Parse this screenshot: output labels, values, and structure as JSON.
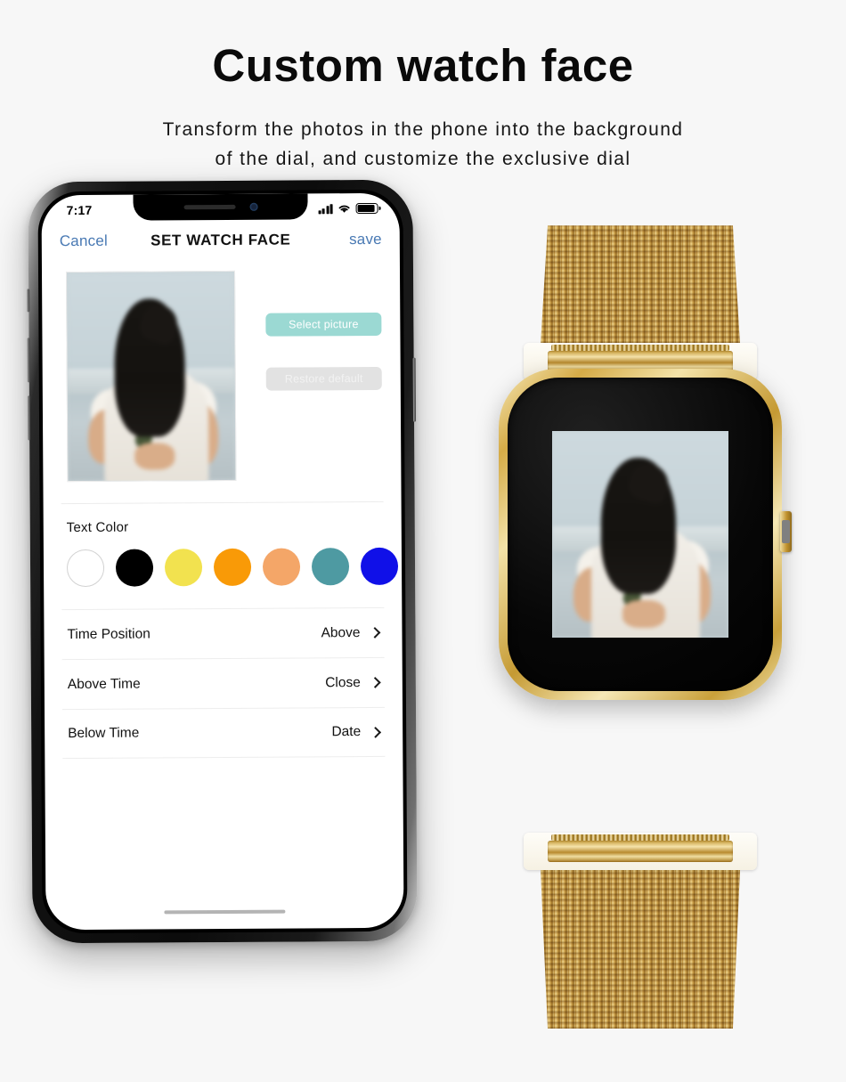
{
  "header": {
    "headline": "Custom watch face",
    "subline_line1": "Transform  the  photos  in  the  phone  into  the  background",
    "subline_line2": "of the dial, and customize the exclusive dial"
  },
  "phone": {
    "status_bar": {
      "time": "7:17",
      "signal_icon": "signal-bars-icon",
      "wifi_icon": "wifi-icon",
      "battery_icon": "battery-icon"
    },
    "nav_bar": {
      "cancel_label": "Cancel",
      "title": "SET WATCH FACE",
      "save_label": "save"
    },
    "editor": {
      "select_picture_label": "Select picture",
      "restore_default_label": "Restore default",
      "select_picture_color": "#9bd9d3",
      "restore_default_color": "#e2e2e2"
    },
    "text_color": {
      "section_label": "Text Color",
      "swatches": [
        {
          "name": "white",
          "hex": "#ffffff",
          "outlined": true
        },
        {
          "name": "black",
          "hex": "#000000",
          "outlined": false
        },
        {
          "name": "yellow",
          "hex": "#f2e24f",
          "outlined": false
        },
        {
          "name": "orange",
          "hex": "#f99a07",
          "outlined": false
        },
        {
          "name": "peach",
          "hex": "#f4a668",
          "outlined": false
        },
        {
          "name": "teal",
          "hex": "#4e9aa2",
          "outlined": false
        },
        {
          "name": "blue",
          "hex": "#1010e8",
          "outlined": false
        }
      ]
    },
    "settings_rows": [
      {
        "label": "Time Position",
        "value": "Above"
      },
      {
        "label": "Above Time",
        "value": "Close"
      },
      {
        "label": "Below Time",
        "value": "Date"
      }
    ]
  },
  "watch": {
    "case_color": "#d5ab47",
    "band_color": "#c79d3c",
    "screen_content": "user-photo-watch-face"
  },
  "theme": {
    "background": "#f7f7f7",
    "link_blue": "#4a7ab4",
    "text_dark": "#111111"
  }
}
